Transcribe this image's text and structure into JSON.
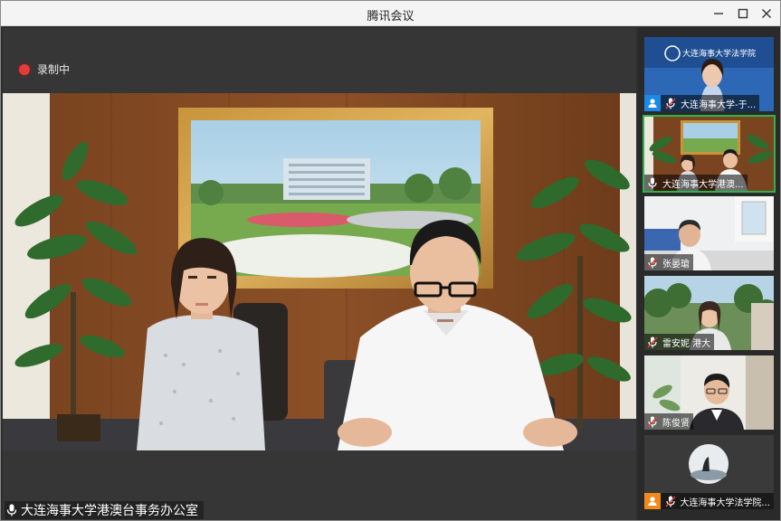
{
  "window": {
    "title": "腾讯会议"
  },
  "recording": {
    "label": "录制中"
  },
  "main_video": {
    "speaker_label": "大连海事大学港澳台事务办公室"
  },
  "sidebar": {
    "tiles": [
      {
        "label": "大连海事大学-于...",
        "banner_text": "大连海事大学法学院",
        "active": false
      },
      {
        "label": "大连海事大学港澳...",
        "active": true
      },
      {
        "label": "张晏瑲",
        "active": false
      },
      {
        "label": "雷安妮 港大",
        "active": false
      },
      {
        "label": "陈俊贤",
        "active": false
      },
      {
        "label": "大连海事大学法学院...",
        "active": false
      }
    ]
  },
  "colors": {
    "recording": "#e13d3d",
    "active_border": "#2fb34a",
    "user_icon": "#1e88e5",
    "user_icon_alt": "#f08a1c"
  }
}
